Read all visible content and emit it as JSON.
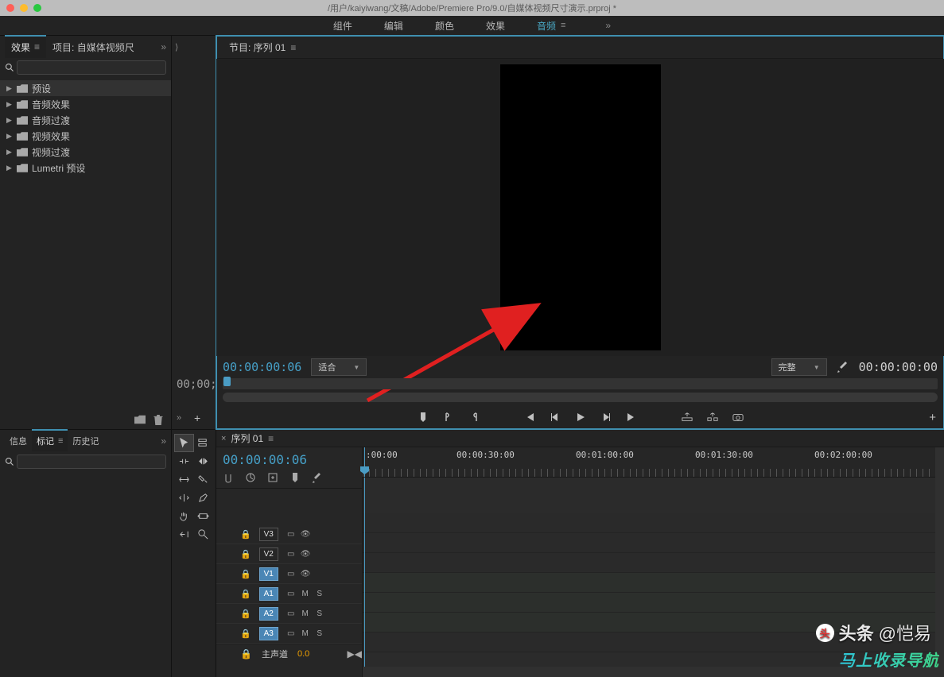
{
  "titlebar": {
    "title": "/用户/kaiyiwang/文稿/Adobe/Premiere Pro/9.0/自媒体视频尺寸演示.prproj *"
  },
  "workspaces": {
    "items": [
      "组件",
      "编辑",
      "颜色",
      "效果",
      "音频"
    ],
    "active_index": 4
  },
  "left_top": {
    "tabs": {
      "effects": "效果",
      "project": "项目: 自媒体视频尺"
    },
    "active_tab": "effects",
    "search_placeholder": "",
    "tree": [
      {
        "label": "预设"
      },
      {
        "label": "音频效果"
      },
      {
        "label": "音频过渡"
      },
      {
        "label": "视频效果"
      },
      {
        "label": "视频过渡"
      },
      {
        "label": "Lumetri 预设"
      }
    ]
  },
  "left_bottom": {
    "tabs": {
      "info": "信息",
      "markers": "标记",
      "history": "历史记"
    },
    "active_tab": "markers"
  },
  "mid_top": {
    "time_fragment": "00;00;"
  },
  "program_monitor": {
    "tab_label": "节目: 序列 01",
    "timecode_current": "00:00:00:06",
    "zoom_label": "适合",
    "quality_label": "完整",
    "timecode_duration": "00:00:00:00"
  },
  "timeline": {
    "sequence_tab": "序列 01",
    "timecode": "00:00:00:06",
    "ruler_labels": [
      {
        "text": ":00:00",
        "pos": 0
      },
      {
        "text": "00:00:30:00",
        "pos": 150
      },
      {
        "text": "00:01:00:00",
        "pos": 300
      },
      {
        "text": "00:01:30:00",
        "pos": 450
      },
      {
        "text": "00:02:00:00",
        "pos": 600
      }
    ],
    "video_tracks": [
      {
        "name": "V3",
        "selected": false
      },
      {
        "name": "V2",
        "selected": false
      },
      {
        "name": "V1",
        "selected": true
      }
    ],
    "audio_tracks": [
      {
        "name": "A1",
        "selected": true
      },
      {
        "name": "A2",
        "selected": true
      },
      {
        "name": "A3",
        "selected": true
      }
    ],
    "master": {
      "label": "主声道",
      "value": "0.0"
    }
  },
  "watermarks": {
    "toutiao_prefix": "头条",
    "toutiao_user": "@恺易",
    "footer": "马上收录导航"
  }
}
